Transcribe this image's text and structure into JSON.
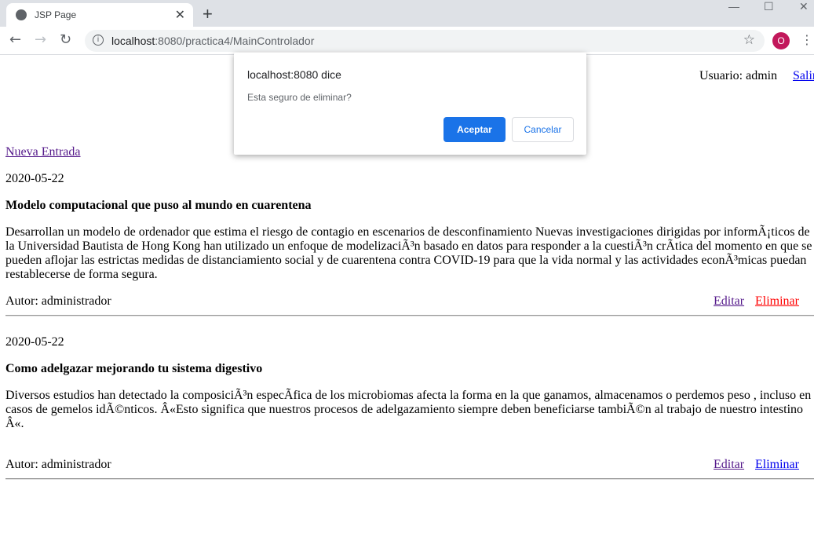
{
  "browser": {
    "tab_title": "JSP Page",
    "url_host": "localhost",
    "url_rest": ":8080/practica4/MainControlador",
    "avatar_letter": "O"
  },
  "header": {
    "user_label": "Usuario: admin",
    "logout": "Salir"
  },
  "new_entry": "Nueva Entrada",
  "posts": [
    {
      "date": "2020-05-22",
      "title": "Modelo computacional que puso al mundo en cuarentena",
      "body": "Desarrollan un modelo de ordenador que estima el riesgo de contagio en escenarios de desconfinamiento Nuevas investigaciones dirigidas por informÃ¡ticos de la Universidad Bautista de Hong Kong han utilizado un enfoque de modelizaciÃ³n basado en datos para responder a la cuestiÃ³n crÃ­tica del momento en que se pueden aflojar las estrictas medidas de distanciamiento social y de cuarentena contra COVID-19 para que la vida normal y las actividades econÃ³micas puedan restablecerse de forma segura.",
      "author": "Autor: administrador",
      "edit": "Editar",
      "delete": "Eliminar"
    },
    {
      "date": "2020-05-22",
      "title": "Como adelgazar mejorando tu sistema digestivo",
      "body": "Diversos estudios han detectado la composiciÃ³n especÃ­fica de los microbiomas afecta la forma en la que ganamos, almacenamos o perdemos peso , incluso en casos de gemelos idÃ©nticos. Â«Esto significa que nuestros procesos de adelgazamiento siempre deben beneficiarse tambiÃ©n al trabajo de nuestro intestino Â«.",
      "author": "Autor: administrador",
      "edit": "Editar",
      "delete": "Eliminar"
    }
  ],
  "dialog": {
    "title": "localhost:8080 dice",
    "message": "Esta seguro de eliminar?",
    "ok": "Aceptar",
    "cancel": "Cancelar"
  }
}
